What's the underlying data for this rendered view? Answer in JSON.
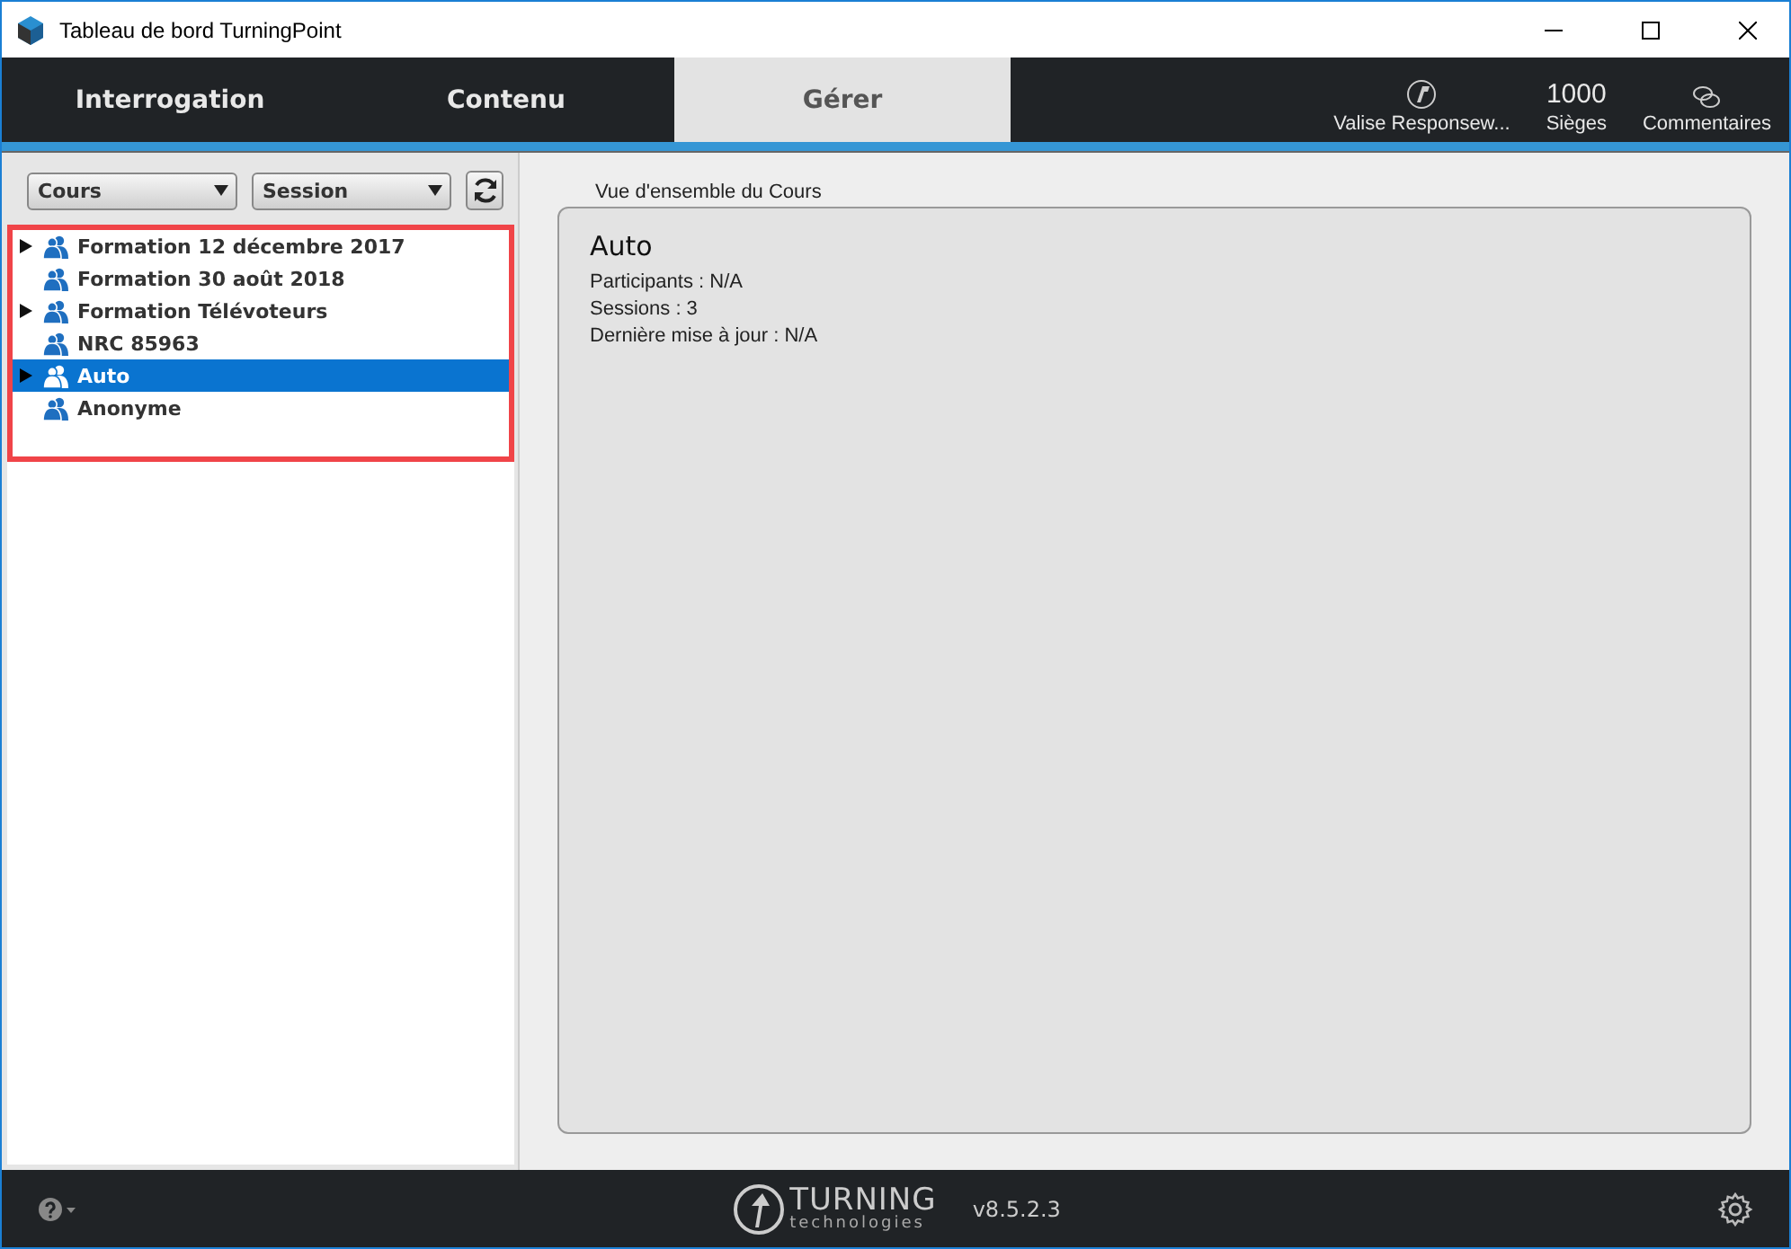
{
  "window": {
    "title": "Tableau de bord TurningPoint"
  },
  "tabs": [
    {
      "label": "Interrogation",
      "selected": false
    },
    {
      "label": "Contenu",
      "selected": false
    },
    {
      "label": "Gérer",
      "selected": true
    }
  ],
  "status_items": [
    {
      "kind": "icon",
      "label": "Valise Responsew..."
    },
    {
      "kind": "count",
      "value": "1000",
      "label": "Sièges"
    },
    {
      "kind": "comments",
      "label": "Commentaires"
    }
  ],
  "filters": [
    {
      "label": "Cours"
    },
    {
      "label": "Session"
    }
  ],
  "tree": {
    "highlighted": true,
    "items": [
      {
        "label": "Formation 12 décembre 2017",
        "has_children": true,
        "selected": false
      },
      {
        "label": "Formation 30 août 2018",
        "has_children": false,
        "selected": false
      },
      {
        "label": "Formation Télévoteurs",
        "has_children": true,
        "selected": false
      },
      {
        "label": "NRC 85963",
        "has_children": false,
        "selected": false
      },
      {
        "label": "Auto",
        "has_children": true,
        "selected": true
      },
      {
        "label": "Anonyme",
        "has_children": false,
        "selected": false
      }
    ]
  },
  "overview": {
    "caption": "Vue d'ensemble du Cours",
    "title": "Auto",
    "details": [
      "Participants : N/A",
      "Sessions : 3",
      "Dernière mise à jour : N/A"
    ]
  },
  "footer": {
    "logo_main": "TURNING",
    "logo_sub": "technologies",
    "version": "v8.5.2.3"
  }
}
